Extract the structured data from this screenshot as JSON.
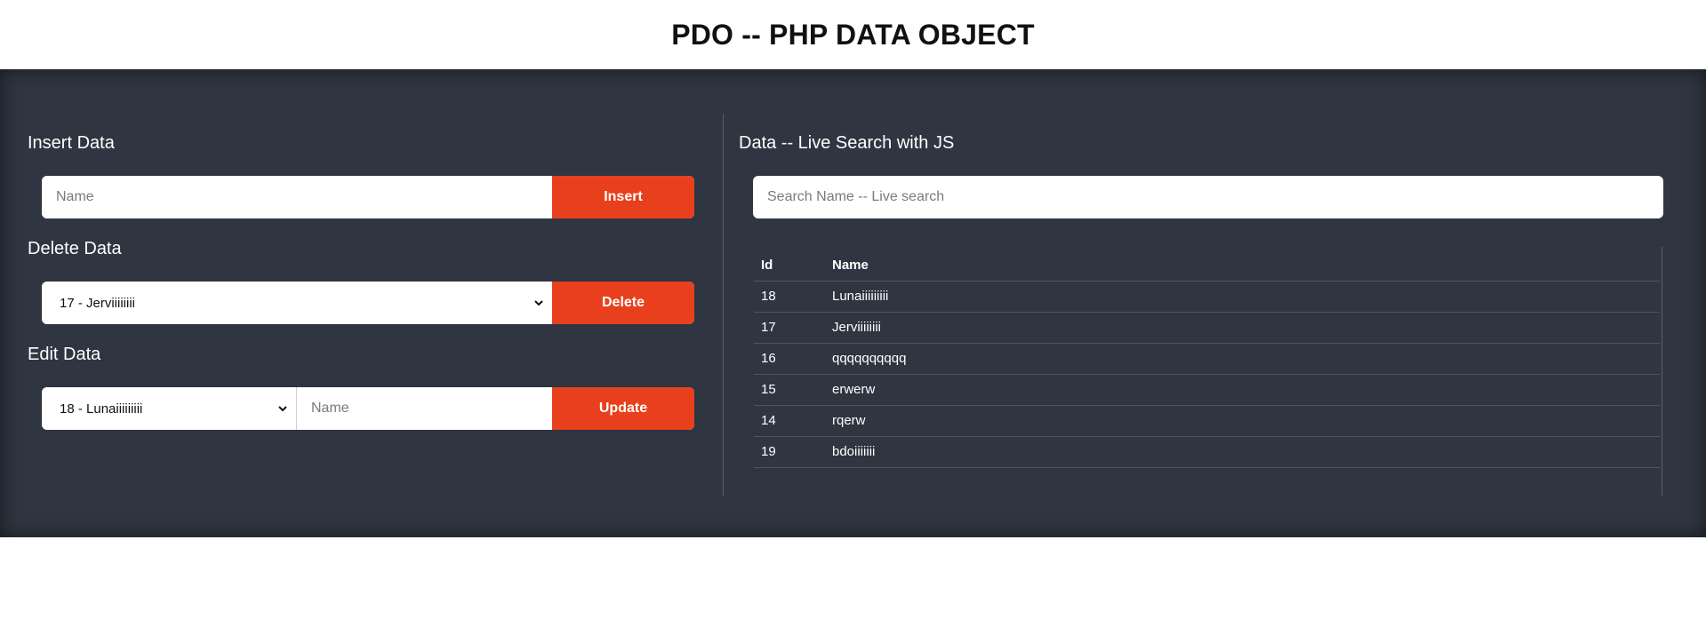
{
  "header": {
    "title": "PDO -- PHP DATA OBJECT"
  },
  "insert": {
    "title": "Insert Data",
    "name_placeholder": "Name",
    "button_label": "Insert"
  },
  "delete": {
    "title": "Delete Data",
    "selected": "17 - Jerviiiiiiii",
    "button_label": "Delete"
  },
  "edit": {
    "title": "Edit Data",
    "selected": "18 - Lunaiiiiiiiii",
    "name_placeholder": "Name",
    "button_label": "Update"
  },
  "search": {
    "title": "Data -- Live Search with JS",
    "placeholder": "Search Name -- Live search"
  },
  "table": {
    "headers": [
      "Id",
      "Name"
    ],
    "rows": [
      {
        "id": "18",
        "name": "Lunaiiiiiiiii"
      },
      {
        "id": "17",
        "name": "Jerviiiiiiii"
      },
      {
        "id": "16",
        "name": "qqqqqqqqqq"
      },
      {
        "id": "15",
        "name": "erwerw"
      },
      {
        "id": "14",
        "name": "rqerw"
      },
      {
        "id": "19",
        "name": "bdoiiiiiii"
      }
    ]
  },
  "colors": {
    "panel_bg": "#2f3541",
    "accent": "#e8401c"
  },
  "icons": {
    "select_chevron": "chevron-down-icon"
  }
}
